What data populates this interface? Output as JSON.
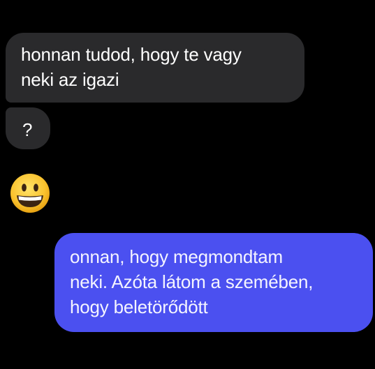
{
  "conversation": {
    "received": [
      {
        "lines": [
          "honnan tudod, hogy te vagy",
          "neki az igazi"
        ]
      },
      {
        "lines": [
          "?"
        ]
      }
    ],
    "reaction_emoji": {
      "icon": "grinning-face-emoji"
    },
    "sent": {
      "lines": [
        "onnan, hogy megmondtam",
        "neki. Azóta látom a szemében,",
        "hogy beletörődött"
      ]
    }
  },
  "colors": {
    "background": "#000000",
    "received_bubble": "#2a2a2c",
    "sent_bubble": "#4b50f0",
    "text": "#ffffff"
  }
}
